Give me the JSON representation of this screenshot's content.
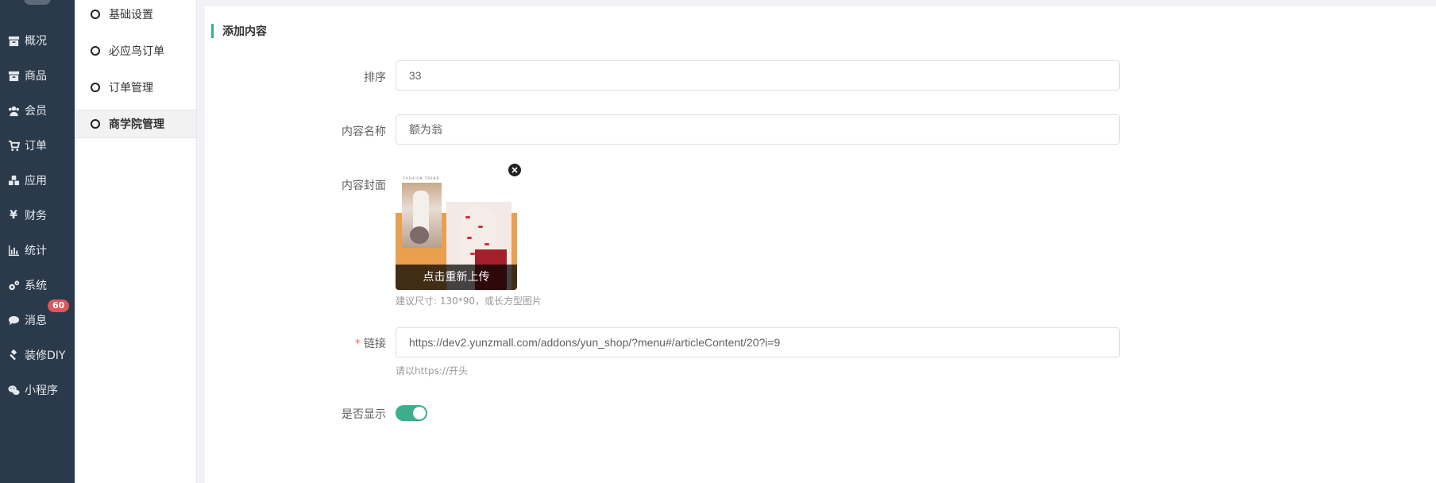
{
  "nav": {
    "items": [
      {
        "label": "概况",
        "icon": "box-icon"
      },
      {
        "label": "商品",
        "icon": "box-icon"
      },
      {
        "label": "会员",
        "icon": "users-icon"
      },
      {
        "label": "订单",
        "icon": "cart-icon"
      },
      {
        "label": "应用",
        "icon": "cubes-icon"
      },
      {
        "label": "财务",
        "icon": "yen-icon"
      },
      {
        "label": "统计",
        "icon": "bar-chart-icon"
      },
      {
        "label": "系统",
        "icon": "gears-icon"
      },
      {
        "label": "消息",
        "icon": "comment-icon",
        "badge": "60"
      },
      {
        "label": "装修DIY",
        "icon": "gavel-icon"
      },
      {
        "label": "小程序",
        "icon": "wechat-icon"
      }
    ]
  },
  "subnav": {
    "items": [
      {
        "label": "基础设置"
      },
      {
        "label": "必应鸟订单"
      },
      {
        "label": "订单管理"
      },
      {
        "label": "商学院管理",
        "active": true
      }
    ]
  },
  "form": {
    "section_title": "添加内容",
    "sort": {
      "label": "排序",
      "value": "33"
    },
    "name": {
      "label": "内容名称",
      "value": "额为翁"
    },
    "cover": {
      "label": "内容封面",
      "reupload_label": "点击重新上传",
      "hint": "建议尺寸: 130*90，或长方型图片",
      "image_text": "FASHION TREND"
    },
    "link": {
      "required_mark": "*",
      "label": "链接",
      "value": "https://dev2.yunzmall.com/addons/yun_shop/?menu#/articleContent/20?i=9",
      "hint": "请以https://开头"
    },
    "display": {
      "label": "是否显示",
      "enabled": true
    }
  },
  "colors": {
    "accent": "#3dae8c",
    "nav_bg": "#2b3a4a",
    "badge": "#e0555a"
  }
}
